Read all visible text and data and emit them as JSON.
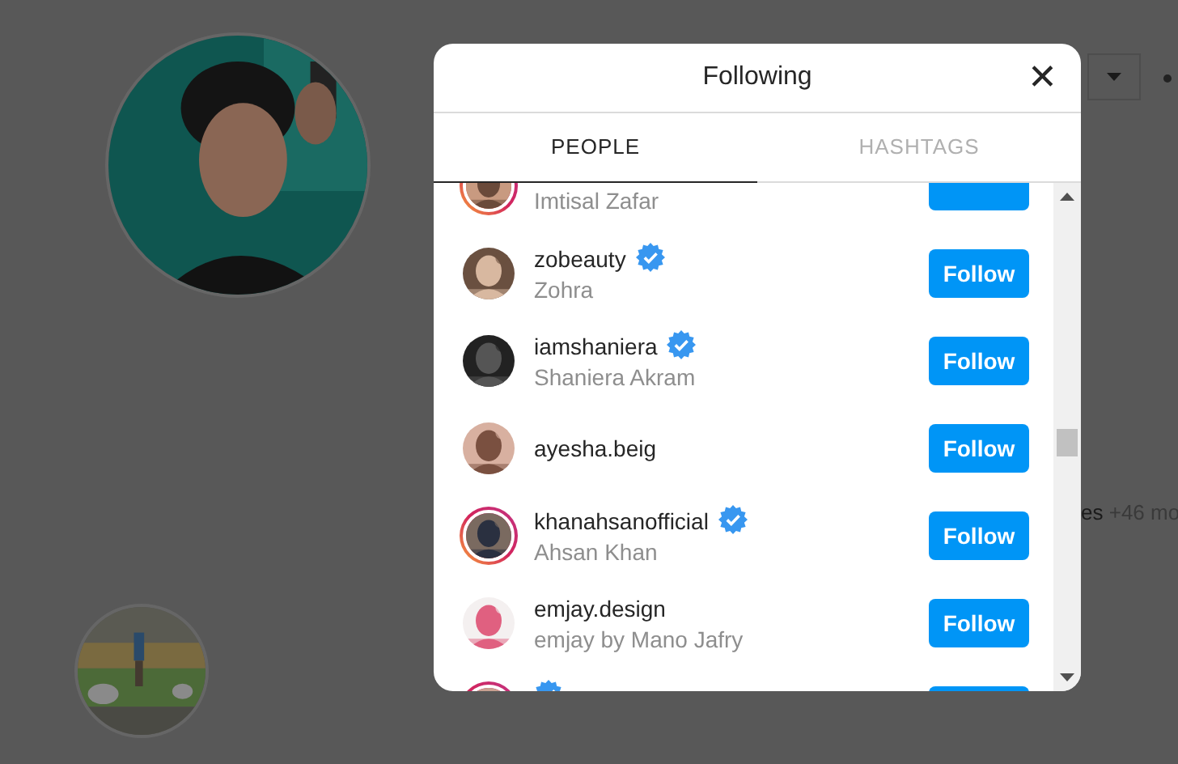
{
  "background": {
    "more_text_a": "es",
    "more_text_b": "+46 mo"
  },
  "dialog": {
    "title": "Following",
    "close_icon": "✕"
  },
  "tabs": [
    {
      "label": "PEOPLE",
      "selected": true
    },
    {
      "label": "HASHTAGS",
      "selected": false
    }
  ],
  "accounts": [
    {
      "full_name": "Imtisal Zafar",
      "verified": false,
      "story": true
    },
    {
      "username": "zobeauty",
      "full_name": "Zohra",
      "verified": true,
      "story": false,
      "button": "Follow"
    },
    {
      "username": "iamshaniera",
      "full_name": "Shaniera Akram",
      "verified": true,
      "story": false,
      "button": "Follow"
    },
    {
      "username": "ayesha.beig",
      "verified": false,
      "story": false,
      "button": "Follow"
    },
    {
      "username": "khanahsanofficial",
      "full_name": "Ahsan Khan",
      "verified": true,
      "story": true,
      "button": "Follow"
    },
    {
      "username": "emjay.design",
      "full_name": "emjay by Mano Jafry",
      "verified": false,
      "story": false,
      "button": "Follow"
    },
    {
      "verified": true,
      "story": true
    }
  ]
}
